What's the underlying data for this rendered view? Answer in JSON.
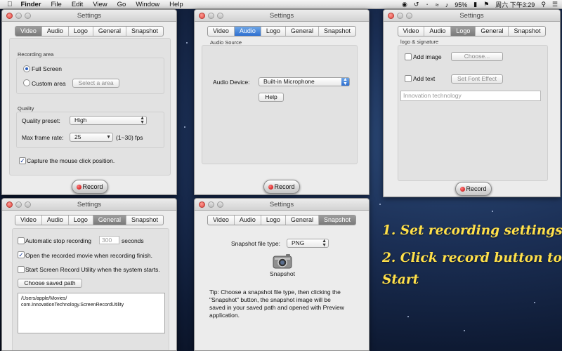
{
  "menubar": {
    "items": [
      "Finder",
      "File",
      "Edit",
      "View",
      "Go",
      "Window",
      "Help"
    ],
    "battery": "95%",
    "clock": "周六 下午3:29"
  },
  "windows": {
    "video": {
      "title": "Settings",
      "tabs": [
        "Video",
        "Audio",
        "Logo",
        "General",
        "Snapshot"
      ],
      "selected_tab": "Video",
      "recording_area_label": "Recording area",
      "full_screen_label": "Full Screen",
      "full_screen_selected": true,
      "custom_area_label": "Custom area",
      "select_area_button": "Select a area",
      "quality_label": "Quality",
      "quality_preset_label": "Quality preset:",
      "quality_preset_value": "High",
      "max_frame_rate_label": "Max frame rate:",
      "max_frame_rate_value": "25",
      "frame_rate_hint": "(1~30) fps",
      "capture_click_label": "Capture the mouse click position.",
      "capture_click_checked": true,
      "record_button": "Record"
    },
    "audio": {
      "title": "Settings",
      "tabs": [
        "Video",
        "Audio",
        "Logo",
        "General",
        "Snapshot"
      ],
      "selected_tab": "Audio",
      "audio_source_label": "Audio Source",
      "audio_device_label": "Audio Device:",
      "audio_device_value": "Built-in Microphone",
      "help_button": "Help",
      "record_button": "Record"
    },
    "logo": {
      "title": "Settings",
      "tabs": [
        "Video",
        "Audio",
        "Logo",
        "General",
        "Snapshot"
      ],
      "selected_tab": "Logo",
      "logo_signature_label": "logo & signature",
      "add_image_label": "Add image",
      "choose_button": "Choose...",
      "add_text_label": "Add text",
      "font_effect_button": "Set Font Effect",
      "text_placeholder": "Innovation technology",
      "record_button": "Record"
    },
    "general": {
      "title": "Settings",
      "tabs": [
        "Video",
        "Audio",
        "Logo",
        "General",
        "Snapshot"
      ],
      "selected_tab": "General",
      "auto_stop_label": "Automatic stop recording",
      "auto_stop_checked": false,
      "auto_stop_value": "300",
      "seconds_label": "seconds",
      "open_movie_label": "Open the recorded movie when recording finish.",
      "open_movie_checked": true,
      "start_utility_label": "Start Screen Record Utility when the system starts.",
      "start_utility_checked": false,
      "choose_path_button": "Choose saved path",
      "saved_path_lines": [
        "/Users/apple/Movies/",
        "com.InnovationTechnology.ScreenRecordUtility"
      ]
    },
    "snapshot": {
      "title": "Settings",
      "tabs": [
        "Video",
        "Audio",
        "Logo",
        "General",
        "Snapshot"
      ],
      "selected_tab": "Snapshot",
      "file_type_label": "Snapshot file type:",
      "file_type_value": "PNG",
      "snapshot_button_label": "Snapshot",
      "tip_lines": [
        "Tip: Choose a snapshot file type, then clicking the",
        "\"Snapshot\" button, the snapshot image will be",
        "saved in your saved path and opened with Preview",
        "application."
      ]
    }
  },
  "promo": {
    "line1": "1. Set recording settings",
    "line2": "2. Click record button to",
    "line3": "Start",
    "color": "#ffe04a"
  },
  "colors": {
    "tab_selected_blue": "#2e6fd0",
    "tab_selected_gray": "#7a7a7a",
    "record_dot": "#c00000"
  }
}
